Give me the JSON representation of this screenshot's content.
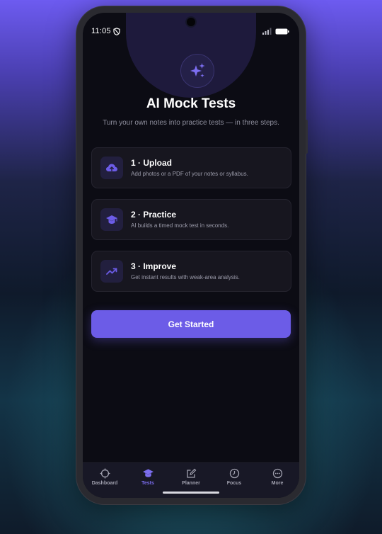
{
  "status_bar": {
    "time": "11:05"
  },
  "hero": {
    "icon": "sparkles-icon",
    "title": "AI Mock Tests",
    "subtitle": "Turn your own notes into practice tests — in three steps."
  },
  "steps": [
    {
      "icon": "cloud-upload-icon",
      "title": "1 · Upload",
      "description": "Add photos or a PDF of your notes or syllabus."
    },
    {
      "icon": "graduation-cap-icon",
      "title": "2 · Practice",
      "description": "AI builds a timed mock test in seconds."
    },
    {
      "icon": "trending-up-icon",
      "title": "3 · Improve",
      "description": "Get instant results with weak-area analysis."
    }
  ],
  "cta": {
    "label": "Get Started"
  },
  "nav": {
    "items": [
      {
        "label": "Dashboard",
        "icon": "crosshair-icon",
        "active": false
      },
      {
        "label": "Tests",
        "icon": "graduation-cap-icon",
        "active": true
      },
      {
        "label": "Planner",
        "icon": "edit-icon",
        "active": false
      },
      {
        "label": "Focus",
        "icon": "timer-icon",
        "active": false
      },
      {
        "label": "More",
        "icon": "more-icon",
        "active": false
      }
    ]
  },
  "colors": {
    "accent": "#6c5ce7",
    "active_nav": "#7c6ef0",
    "screen_bg": "#0c0c14",
    "card_bg": "#17161f"
  }
}
